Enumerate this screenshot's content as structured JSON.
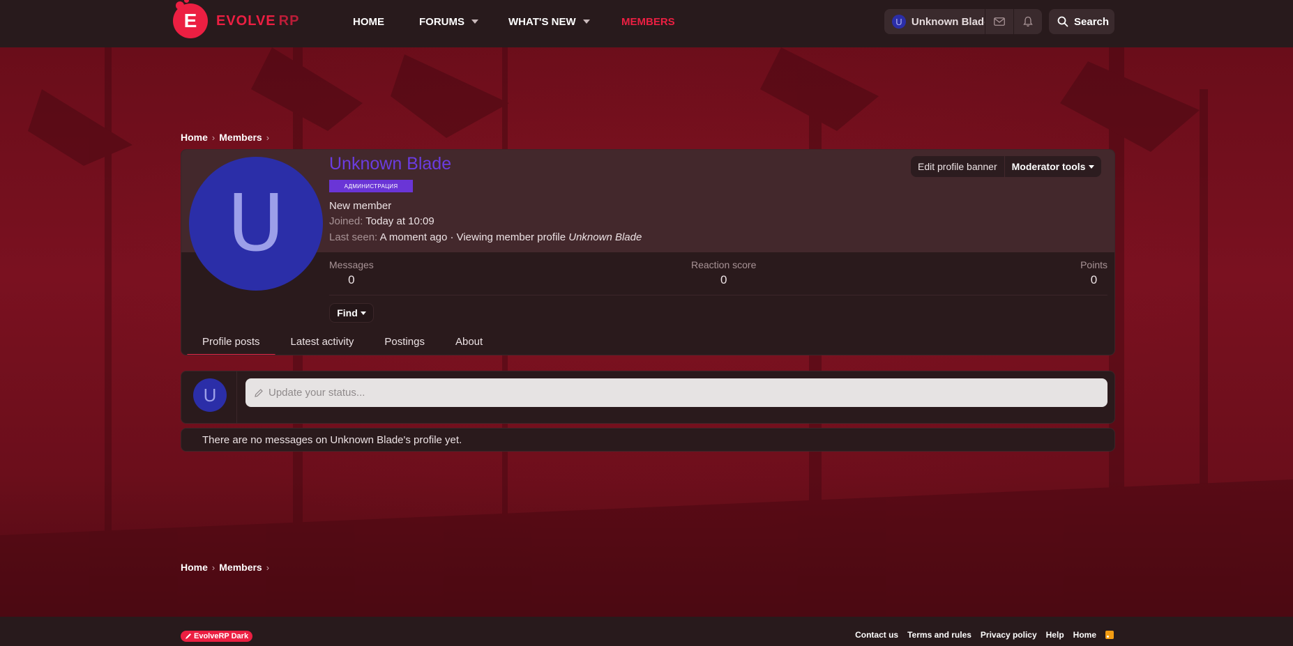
{
  "header": {
    "logo_word1": "EVOLVE",
    "logo_word2": "RP",
    "logo_letter": "E",
    "nav": [
      {
        "label": "HOME"
      },
      {
        "label": "FORUMS"
      },
      {
        "label": "WHAT'S NEW"
      },
      {
        "label": "MEMBERS"
      }
    ],
    "user_initial": "U",
    "user_name": "Unknown Blade",
    "search_label": "Search"
  },
  "breadcrumb": {
    "home": "Home",
    "members": "Members"
  },
  "profile": {
    "avatar_initial": "U",
    "name": "Unknown Blade",
    "banner_badge": "АДМИНИСТРАЦИЯ",
    "user_title": "New member",
    "joined_label": "Joined:",
    "joined_value": "Today at 10:09",
    "last_seen_label": "Last seen:",
    "last_seen_value": "A moment ago · Viewing member profile",
    "last_seen_target": "Unknown Blade",
    "edit_banner_label": "Edit profile banner",
    "moderator_tools_label": "Moderator tools",
    "stats": [
      {
        "label": "Messages",
        "value": "0"
      },
      {
        "label": "Reaction score",
        "value": "0"
      },
      {
        "label": "Points",
        "value": "0"
      }
    ],
    "find_label": "Find",
    "tabs": [
      {
        "label": "Profile posts"
      },
      {
        "label": "Latest activity"
      },
      {
        "label": "Postings"
      },
      {
        "label": "About"
      }
    ]
  },
  "status": {
    "avatar_initial": "U",
    "placeholder": "Update your status..."
  },
  "no_messages": "There are no messages on Unknown Blade's profile yet.",
  "footer": {
    "style_label": "EvolveRP Dark",
    "links": [
      "Contact us",
      "Terms and rules",
      "Privacy policy",
      "Help",
      "Home"
    ]
  },
  "colors": {
    "accent": "#ec1f42",
    "username": "#6b3ce0",
    "avatar": "#2b2ea8",
    "header_bg": "#281a1c"
  }
}
